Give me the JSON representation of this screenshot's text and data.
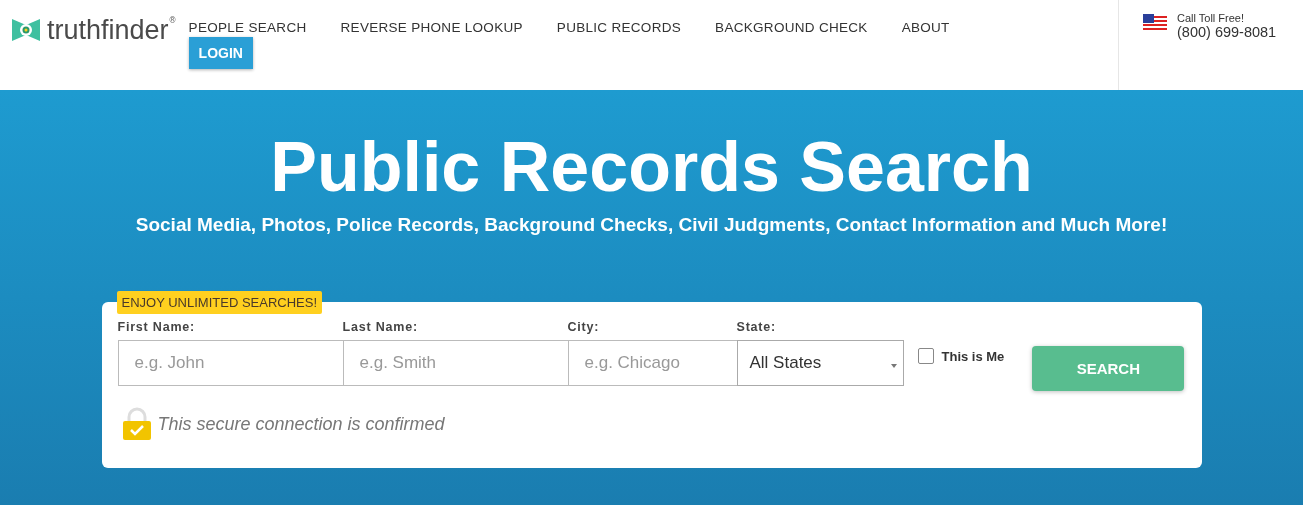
{
  "header": {
    "logo": "truthfinder",
    "logo_mark": "®",
    "nav": [
      {
        "label": "PEOPLE SEARCH"
      },
      {
        "label": "REVERSE PHONE LOOKUP"
      },
      {
        "label": "PUBLIC RECORDS"
      },
      {
        "label": "BACKGROUND CHECK"
      },
      {
        "label": "ABOUT"
      }
    ],
    "login": "LOGIN",
    "phone": {
      "caption": "Call Toll Free!",
      "number": "(800) 699-8081"
    }
  },
  "hero": {
    "title": "Public Records Search",
    "subtitle": "Social Media, Photos, Police Records, Background Checks, Civil Judgments, Contact Information and Much More!"
  },
  "search_form": {
    "badge": "ENJOY UNLIMITED SEARCHES!",
    "fields": [
      {
        "kind": "text",
        "label": "First Name:",
        "placeholder": "e.g. John"
      },
      {
        "kind": "text",
        "label": "Last Name:",
        "placeholder": "e.g. Smith"
      },
      {
        "kind": "text",
        "label": "City:",
        "placeholder": "e.g. Chicago"
      },
      {
        "kind": "select",
        "label": "State:",
        "value": "All States"
      }
    ],
    "this_is_me": {
      "label": "This is Me",
      "checked": false
    },
    "button": "SEARCH",
    "secure_note": "This secure connection is confirmed"
  }
}
